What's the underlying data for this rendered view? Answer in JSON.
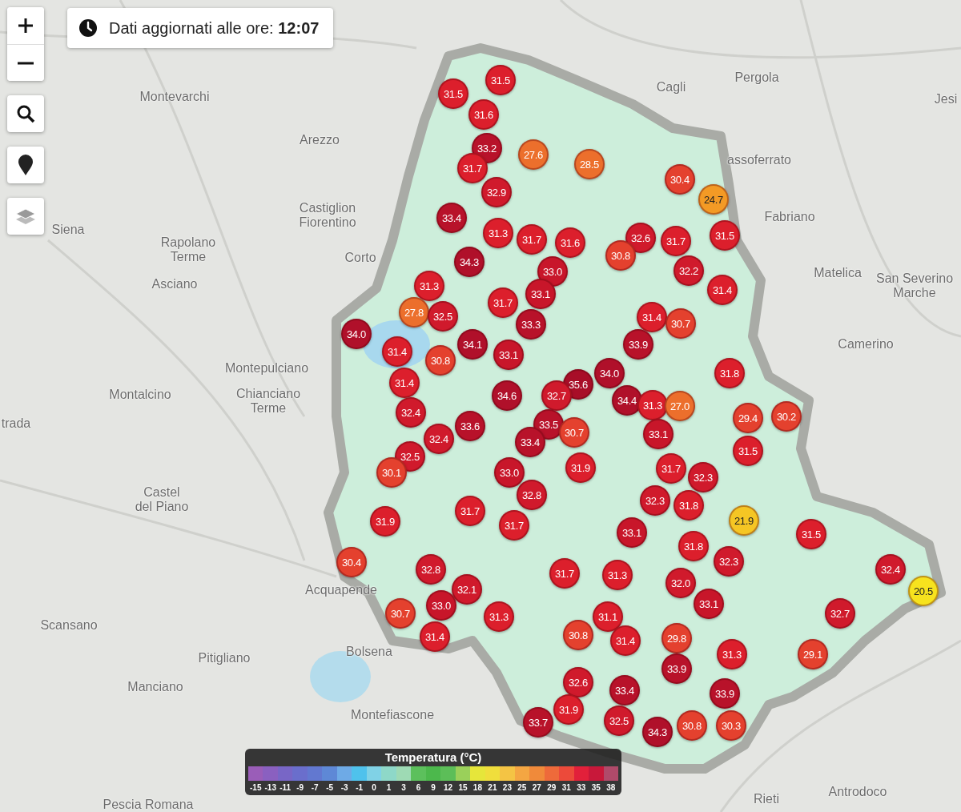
{
  "info": {
    "text": "Dati aggiornati alle ore: **12:07**"
  },
  "places": [
    {
      "name": "Montevarchi"
    },
    {
      "name": "Arezzo"
    },
    {
      "name": "Castiglion Fiorentino"
    },
    {
      "name": "Siena"
    },
    {
      "name": "Rapolano Terme"
    },
    {
      "name": "Corto"
    },
    {
      "name": "Asciano"
    },
    {
      "name": "Montepulciano"
    },
    {
      "name": "Montalcino"
    },
    {
      "name": "Chianciano Terme"
    },
    {
      "name": "trada"
    },
    {
      "name": "Castel del Piano"
    },
    {
      "name": "Acquapende"
    },
    {
      "name": "Scansano"
    },
    {
      "name": "Pitigliano"
    },
    {
      "name": "Bolsena"
    },
    {
      "name": "Manciano"
    },
    {
      "name": "Montefiascone"
    },
    {
      "name": "Pescia Romana"
    },
    {
      "name": "Cagli"
    },
    {
      "name": "Pergola"
    },
    {
      "name": "assoferrato"
    },
    {
      "name": "Fabriano"
    },
    {
      "name": "Matelica"
    },
    {
      "name": "San Severino Marche"
    },
    {
      "name": "Camerino"
    },
    {
      "name": "Jesi"
    },
    {
      "name": "Rieti"
    },
    {
      "name": "Antrodoco"
    }
  ],
  "markers": [
    {
      "value": "31.5",
      "color": "#dc1f2c"
    },
    {
      "value": "31.5",
      "color": "#dc1f2c"
    },
    {
      "value": "31.6",
      "color": "#dc1f2c"
    },
    {
      "value": "33.2",
      "color": "#b8122a"
    },
    {
      "value": "27.6",
      "color": "#ec6f2c"
    },
    {
      "value": "28.5",
      "color": "#ec6f2c"
    },
    {
      "value": "31.7",
      "color": "#dc1f2c"
    },
    {
      "value": "32.9",
      "color": "#d01a2c"
    },
    {
      "value": "33.4",
      "color": "#b8122a"
    },
    {
      "value": "31.3",
      "color": "#dc1f2c"
    },
    {
      "value": "31.7",
      "color": "#dc1f2c"
    },
    {
      "value": "31.6",
      "color": "#dc1f2c"
    },
    {
      "value": "32.6",
      "color": "#d01a2c"
    },
    {
      "value": "31.7",
      "color": "#dc1f2c"
    },
    {
      "value": "30.8",
      "color": "#e4412e"
    },
    {
      "value": "30.4",
      "color": "#e4412e"
    },
    {
      "value": "24.7",
      "color": "#f39a25"
    },
    {
      "value": "31.5",
      "color": "#dc1f2c"
    },
    {
      "value": "32.2",
      "color": "#d01a2c"
    },
    {
      "value": "31.4",
      "color": "#dc1f2c"
    },
    {
      "value": "34.3",
      "color": "#b0102a"
    },
    {
      "value": "33.0",
      "color": "#c8162a"
    },
    {
      "value": "31.3",
      "color": "#dc1f2c"
    },
    {
      "value": "27.8",
      "color": "#ec6f2c"
    },
    {
      "value": "32.5",
      "color": "#d01a2c"
    },
    {
      "value": "31.7",
      "color": "#dc1f2c"
    },
    {
      "value": "33.1",
      "color": "#c8162a"
    },
    {
      "value": "33.3",
      "color": "#b8122a"
    },
    {
      "value": "34.0",
      "color": "#b0102a"
    },
    {
      "value": "31.4",
      "color": "#dc1f2c"
    },
    {
      "value": "30.8",
      "color": "#e4412e"
    },
    {
      "value": "34.1",
      "color": "#b0102a"
    },
    {
      "value": "33.1",
      "color": "#c8162a"
    },
    {
      "value": "31.4",
      "color": "#dc1f2c"
    },
    {
      "value": "30.7",
      "color": "#e4412e"
    },
    {
      "value": "33.9",
      "color": "#b8122a"
    },
    {
      "value": "31.8",
      "color": "#dc1f2c"
    },
    {
      "value": "34.0",
      "color": "#b0102a"
    },
    {
      "value": "35.6",
      "color": "#a80e28"
    },
    {
      "value": "34.6",
      "color": "#b0102a"
    },
    {
      "value": "32.7",
      "color": "#d01a2c"
    },
    {
      "value": "34.4",
      "color": "#b0102a"
    },
    {
      "value": "31.3",
      "color": "#dc1f2c"
    },
    {
      "value": "27.0",
      "color": "#ec6f2c"
    },
    {
      "value": "31.4",
      "color": "#dc1f2c"
    },
    {
      "value": "32.4",
      "color": "#d01a2c"
    },
    {
      "value": "33.5",
      "color": "#b8122a"
    },
    {
      "value": "30.7",
      "color": "#e4412e"
    },
    {
      "value": "33.6",
      "color": "#b8122a"
    },
    {
      "value": "32.4",
      "color": "#d01a2c"
    },
    {
      "value": "32.5",
      "color": "#d01a2c"
    },
    {
      "value": "33.4",
      "color": "#b8122a"
    },
    {
      "value": "33.0",
      "color": "#c8162a"
    },
    {
      "value": "32.8",
      "color": "#d01a2c"
    },
    {
      "value": "31.9",
      "color": "#dc1f2c"
    },
    {
      "value": "33.1",
      "color": "#c8162a"
    },
    {
      "value": "29.4",
      "color": "#e4412e"
    },
    {
      "value": "30.2",
      "color": "#e4412e"
    },
    {
      "value": "31.5",
      "color": "#dc1f2c"
    },
    {
      "value": "31.7",
      "color": "#dc1f2c"
    },
    {
      "value": "32.3",
      "color": "#d01a2c"
    },
    {
      "value": "32.3",
      "color": "#d01a2c"
    },
    {
      "value": "31.8",
      "color": "#dc1f2c"
    },
    {
      "value": "21.9",
      "color": "#f5c624"
    },
    {
      "value": "33.1",
      "color": "#c8162a"
    },
    {
      "value": "31.7",
      "color": "#dc1f2c"
    },
    {
      "value": "31.7",
      "color": "#dc1f2c"
    },
    {
      "value": "30.1",
      "color": "#e4412e"
    },
    {
      "value": "31.9",
      "color": "#dc1f2c"
    },
    {
      "value": "30.4",
      "color": "#e4412e"
    },
    {
      "value": "32.8",
      "color": "#d01a2c"
    },
    {
      "value": "32.1",
      "color": "#d01a2c"
    },
    {
      "value": "33.0",
      "color": "#c8162a"
    },
    {
      "value": "30.7",
      "color": "#e4412e"
    },
    {
      "value": "31.4",
      "color": "#dc1f2c"
    },
    {
      "value": "31.7",
      "color": "#dc1f2c"
    },
    {
      "value": "31.3",
      "color": "#dc1f2c"
    },
    {
      "value": "31.8",
      "color": "#dc1f2c"
    },
    {
      "value": "32.3",
      "color": "#d01a2c"
    },
    {
      "value": "32.0",
      "color": "#d01a2c"
    },
    {
      "value": "33.1",
      "color": "#c8162a"
    },
    {
      "value": "31.5",
      "color": "#dc1f2c"
    },
    {
      "value": "32.4",
      "color": "#d01a2c"
    },
    {
      "value": "20.5",
      "color": "#f7e31e"
    },
    {
      "value": "32.7",
      "color": "#d01a2c"
    },
    {
      "value": "29.1",
      "color": "#e4412e"
    },
    {
      "value": "31.3",
      "color": "#dc1f2c"
    },
    {
      "value": "31.1",
      "color": "#dc1f2c"
    },
    {
      "value": "31.4",
      "color": "#dc1f2c"
    },
    {
      "value": "30.8",
      "color": "#e4412e"
    },
    {
      "value": "29.8",
      "color": "#e4412e"
    },
    {
      "value": "33.9",
      "color": "#b8122a"
    },
    {
      "value": "31.3",
      "color": "#dc1f2c"
    },
    {
      "value": "32.6",
      "color": "#d01a2c"
    },
    {
      "value": "33.4",
      "color": "#b8122a"
    },
    {
      "value": "33.9",
      "color": "#b8122a"
    },
    {
      "value": "31.9",
      "color": "#dc1f2c"
    },
    {
      "value": "33.7",
      "color": "#b8122a"
    },
    {
      "value": "32.5",
      "color": "#d01a2c"
    },
    {
      "value": "34.3",
      "color": "#b0102a"
    },
    {
      "value": "30.8",
      "color": "#e4412e"
    },
    {
      "value": "30.3",
      "color": "#e4412e"
    }
  ],
  "legend": {
    "title": "Temperatura (°C)",
    "steps": [
      {
        "label": "-15",
        "color": "#9a5db8"
      },
      {
        "label": "-13",
        "color": "#8a60c0"
      },
      {
        "label": "-11",
        "color": "#7866c6"
      },
      {
        "label": "-9",
        "color": "#6a6ecc"
      },
      {
        "label": "-7",
        "color": "#6278d0"
      },
      {
        "label": "-5",
        "color": "#5e88d6"
      },
      {
        "label": "-3",
        "color": "#6eaae6"
      },
      {
        "label": "-1",
        "color": "#4fc2ec"
      },
      {
        "label": "0",
        "color": "#80d2e6"
      },
      {
        "label": "1",
        "color": "#8ed8c8"
      },
      {
        "label": "3",
        "color": "#9edab4"
      },
      {
        "label": "6",
        "color": "#5cc05c"
      },
      {
        "label": "9",
        "color": "#4cb84c"
      },
      {
        "label": "12",
        "color": "#5cbe58"
      },
      {
        "label": "15",
        "color": "#9ad05a"
      },
      {
        "label": "18",
        "color": "#e6e63a"
      },
      {
        "label": "21",
        "color": "#f0de3c"
      },
      {
        "label": "23",
        "color": "#f4c444"
      },
      {
        "label": "25",
        "color": "#f4a642"
      },
      {
        "label": "27",
        "color": "#f08a3a"
      },
      {
        "label": "29",
        "color": "#ee6a3a"
      },
      {
        "label": "31",
        "color": "#ec4a3a"
      },
      {
        "label": "33",
        "color": "#e2203a"
      },
      {
        "label": "35",
        "color": "#c8183a"
      },
      {
        "label": "38",
        "color": "#b04a6a"
      }
    ]
  }
}
